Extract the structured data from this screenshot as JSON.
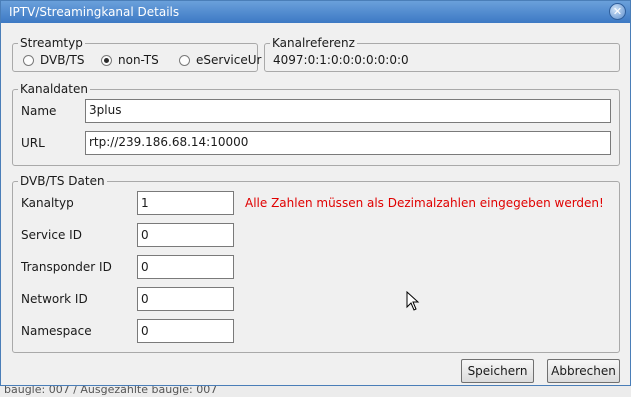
{
  "window": {
    "title": "IPTV/Streamingkanal Details"
  },
  "underlying": {
    "status_text": "baugle: 007 / Ausgezählte baugle: 007"
  },
  "streamtyp": {
    "legend": "Streamtyp",
    "options": [
      {
        "label": "DVB/TS",
        "selected": false
      },
      {
        "label": "non-TS",
        "selected": true
      },
      {
        "label": "eServiceUr",
        "selected": false
      }
    ]
  },
  "kanalreferenz": {
    "legend": "Kanalreferenz",
    "value": "4097:0:1:0:0:0:0:0:0:0"
  },
  "kanaldaten": {
    "legend": "Kanaldaten",
    "name_label": "Name",
    "name_value": "3plus",
    "url_label": "URL",
    "url_value": "rtp://239.186.68.14:10000"
  },
  "dvbts": {
    "legend": "DVB/TS Daten",
    "fields": [
      {
        "label": "Kanaltyp",
        "value": "1"
      },
      {
        "label": "Service ID",
        "value": "0"
      },
      {
        "label": "Transponder ID",
        "value": "0"
      },
      {
        "label": "Network ID",
        "value": "0"
      },
      {
        "label": "Namespace",
        "value": "0"
      }
    ],
    "error": "Alle Zahlen müssen als Dezimalzahlen eingegeben werden!",
    "error_color": "#e00000"
  },
  "buttons": {
    "save": "Speichern",
    "cancel": "Abbrechen"
  },
  "icons": {
    "close": "close-icon",
    "cursor": "mouse-cursor-icon"
  }
}
